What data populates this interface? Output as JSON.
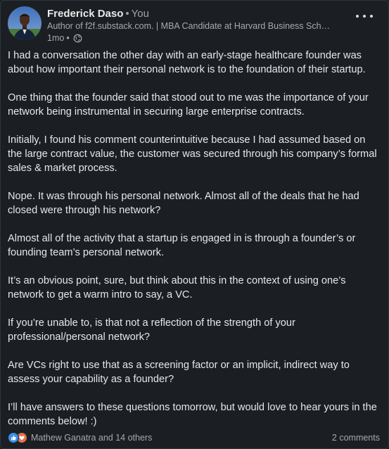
{
  "author": {
    "name": "Frederick Daso",
    "relation": "You",
    "headline": "Author of f2f.substack.com. | MBA Candidate at Harvard Business Sch…",
    "time": "1mo"
  },
  "post": {
    "paragraphs": [
      "I had a conversation the other day with an early-stage healthcare founder was about how important their personal network is to the foundation of their startup.",
      "One thing that the founder said that stood out to me was the importance of your network being instrumental in securing large enterprise contracts.",
      "Initially, I found his comment counterintuitive because I had assumed based on the large contract value, the customer was secured through his company’s formal sales & market process.",
      "Nope. It was through his personal network. Almost all of the deals that he had closed were through his network?",
      "Almost all of the activity that a startup is engaged in is through a founder’s or founding team’s personal network.",
      "It’s an obvious point, sure, but think about this in the context of using one’s network to get a warm intro to say, a VC.",
      "If you’re unable to, is that not a reflection of the strength of your professional/personal network?",
      "Are VCs right to use that as a screening factor or an implicit, indirect way to assess your capability as a founder?",
      "I’ll have answers to these questions tomorrow, but would love to hear yours in the comments below! :)"
    ]
  },
  "social": {
    "reactors": "Mathew Ganatra and 14 others",
    "comments": "2 comments"
  },
  "icons": {
    "menu": "more-horizontal-icon",
    "visibility": "globe-icon",
    "reaction_like": "like-icon",
    "reaction_love": "heart-icon"
  },
  "colors": {
    "background": "#1b1f23",
    "like": "#378fe9",
    "love": "#df704d"
  }
}
